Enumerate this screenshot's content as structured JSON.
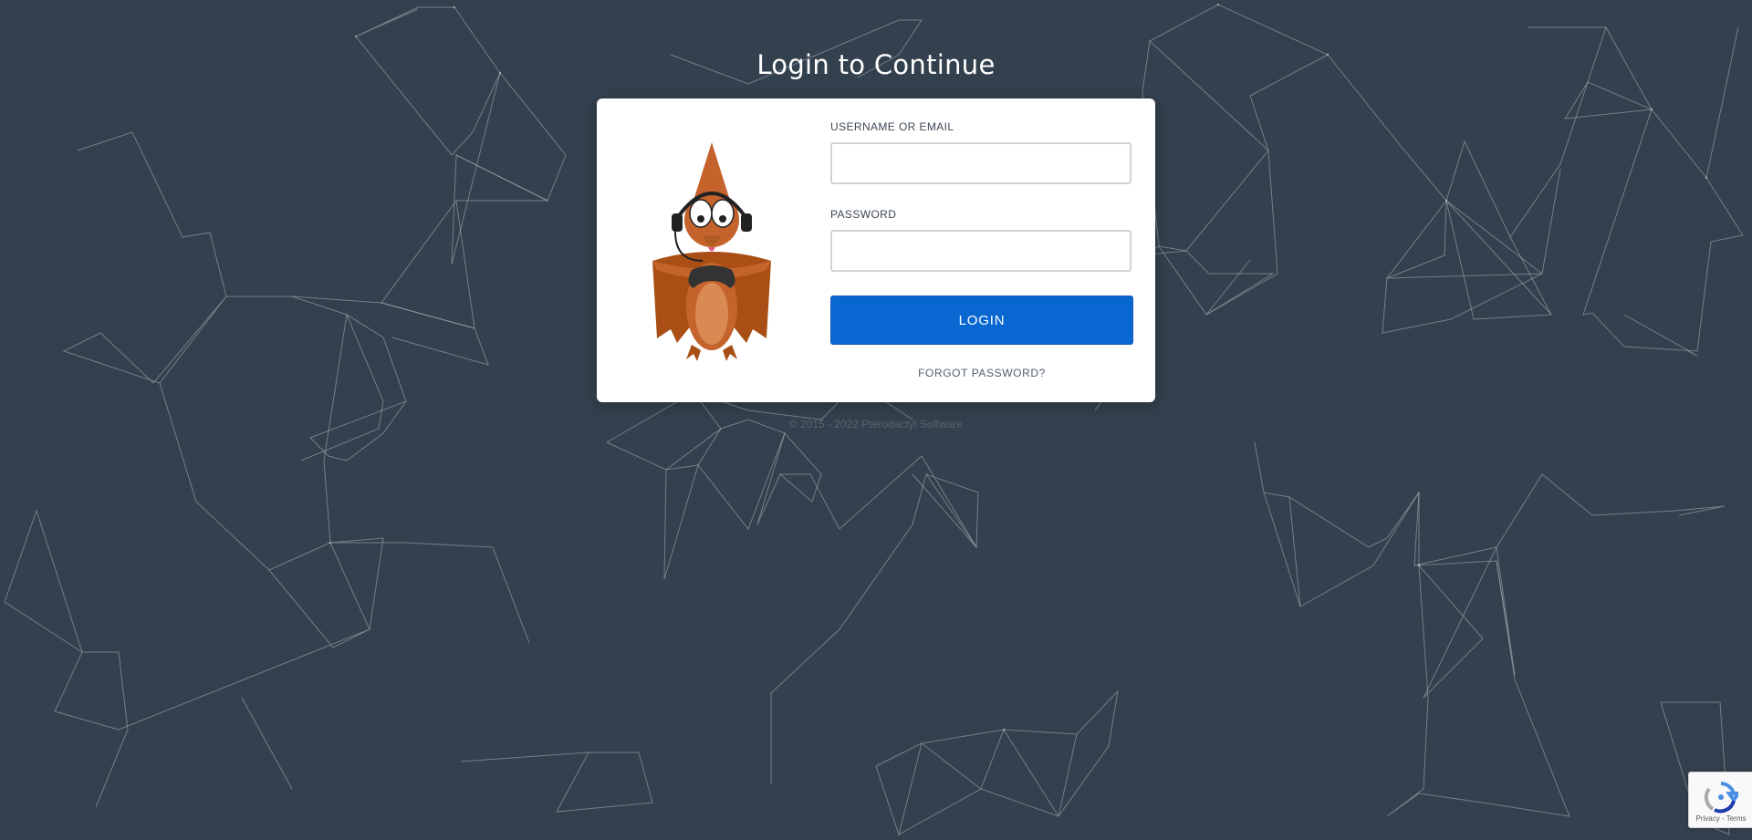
{
  "page": {
    "title": "Login to Continue"
  },
  "form": {
    "username_label": "USERNAME OR EMAIL",
    "username_value": "",
    "password_label": "PASSWORD",
    "password_value": "",
    "login_button": "LOGIN",
    "forgot_link": "FORGOT PASSWORD?"
  },
  "footer": {
    "copyright": "© 2015 - 2022 Pterodactyl Software"
  },
  "recaptcha": {
    "links": "Privacy - Terms"
  },
  "colors": {
    "background": "#33404d",
    "button": "#0967d2",
    "card": "#ffffff",
    "mascot": "#c4642c"
  },
  "icons": {
    "logo": "pterodactyl-mascot",
    "recaptcha": "recaptcha-icon"
  }
}
